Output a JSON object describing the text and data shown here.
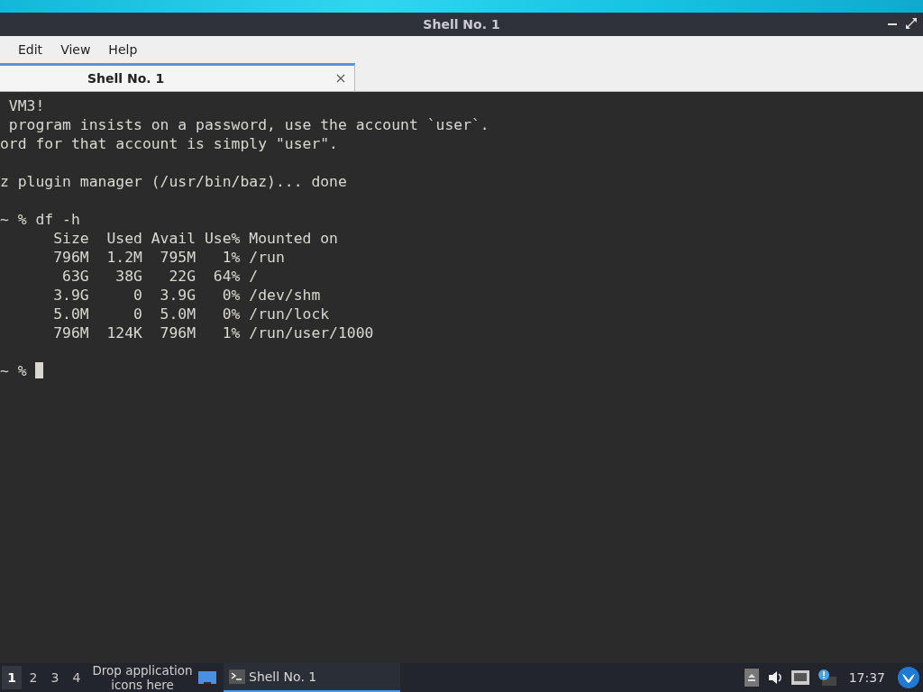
{
  "window": {
    "title": "Shell No. 1"
  },
  "menu": [
    "Edit",
    "View",
    "Help"
  ],
  "tabs": [
    {
      "label": "Shell No. 1",
      "selected": true
    }
  ],
  "terminal": {
    "blocks": [
      [
        " VM3!",
        " program insists on a password, use the account `user`.",
        "ord for that account is simply \"user\"."
      ],
      [
        "z plugin manager (/usr/bin/baz)... done"
      ],
      [
        "~ % df -h",
        "      Size  Used Avail Use% Mounted on",
        "      796M  1.2M  795M   1% /run",
        "       63G   38G   22G  64% /",
        "      3.9G     0  3.9G   0% /dev/shm",
        "      5.0M     0  5.0M   0% /run/lock",
        "      796M  124K  796M   1% /run/user/1000"
      ]
    ],
    "prompt": "~ % "
  },
  "taskbar": {
    "desktops": [
      {
        "label": "1",
        "selected": true
      },
      {
        "label": "2",
        "selected": false
      },
      {
        "label": "3",
        "selected": false
      },
      {
        "label": "4",
        "selected": false
      }
    ],
    "drop_hint": "Drop application icons here",
    "tasks": [
      {
        "label": "Shell No. 1",
        "selected": true
      }
    ],
    "clock": "17:37"
  }
}
